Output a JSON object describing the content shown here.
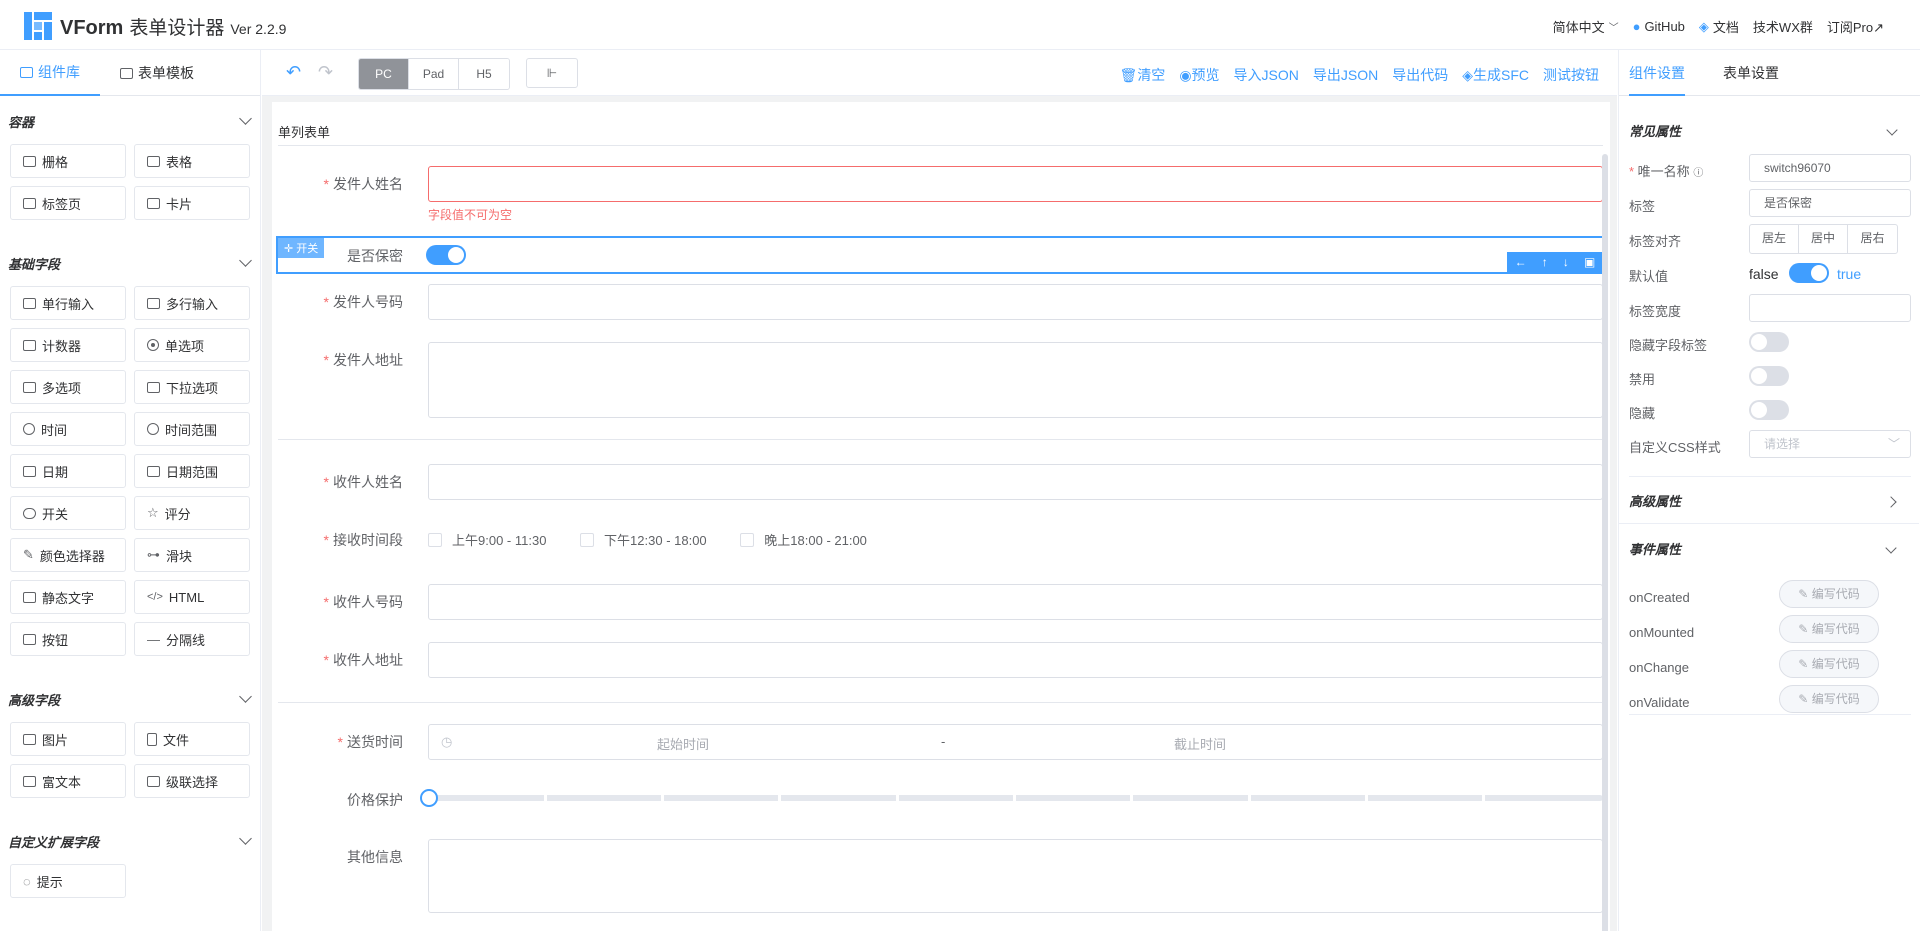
{
  "app": {
    "brand": "VForm",
    "title_zh": "表单设计器",
    "version": "Ver 2.2.9",
    "nav": {
      "lang": "简体中文",
      "github": "GitHub",
      "docs": "文档",
      "wx": "技术WX群",
      "pro": "订阅Pro↗"
    }
  },
  "left": {
    "tabs": [
      "组件库",
      "表单模板"
    ],
    "sections": [
      {
        "title": "容器",
        "items": [
          "栅格",
          "表格",
          "标签页",
          "卡片"
        ]
      },
      {
        "title": "基础字段",
        "items": [
          "单行输入",
          "多行输入",
          "计数器",
          "单选项",
          "多选项",
          "下拉选项",
          "时间",
          "时间范围",
          "日期",
          "日期范围",
          "开关",
          "评分",
          "颜色选择器",
          "滑块",
          "静态文字",
          "HTML",
          "按钮",
          "分隔线"
        ]
      },
      {
        "title": "高级字段",
        "items": [
          "图片",
          "文件",
          "富文本",
          "级联选择"
        ]
      },
      {
        "title": "自定义扩展字段",
        "items": [
          "提示"
        ]
      }
    ]
  },
  "toolbar": {
    "devices": [
      "PC",
      "Pad",
      "H5"
    ],
    "active_device": "PC",
    "actions": [
      "清空",
      "预览",
      "导入JSON",
      "导出JSON",
      "导出代码",
      "生成SFC",
      "测试按钮"
    ]
  },
  "form": {
    "title": "单列表单",
    "sender_name": "发件人姓名",
    "error": "字段值不可为空",
    "selected_tag": "开关",
    "secret": "是否保密",
    "sender_phone": "发件人号码",
    "sender_addr": "发件人地址",
    "recv_name": "收件人姓名",
    "recv_time": "接收时间段",
    "time_options": [
      "上午9:00 - 11:30",
      "下午12:30 - 18:00",
      "晚上18:00 - 21:00"
    ],
    "recv_phone": "收件人号码",
    "recv_addr": "收件人地址",
    "delivery": "送货时间",
    "start_ph": "起始时间",
    "sep": "-",
    "end_ph": "截止时间",
    "price": "价格保护",
    "other": "其他信息"
  },
  "right": {
    "tabs": [
      "组件设置",
      "表单设置"
    ],
    "common_title": "常见属性",
    "unique_label": "唯一名称",
    "unique_value": "switch96070",
    "label_label": "标签",
    "label_value": "是否保密",
    "align_label": "标签对齐",
    "align_options": [
      "居左",
      "居中",
      "居右"
    ],
    "default_label": "默认值",
    "default_false": "false",
    "default_true": "true",
    "width_label": "标签宽度",
    "hide_label_label": "隐藏字段标签",
    "disabled_label": "禁用",
    "hidden_label": "隐藏",
    "css_label": "自定义CSS样式",
    "css_placeholder": "请选择",
    "advanced_title": "高级属性",
    "event_title": "事件属性",
    "events": [
      "onCreated",
      "onMounted",
      "onChange",
      "onValidate"
    ],
    "code_btn": "编写代码"
  },
  "colors": {
    "accent": "#409eff",
    "error": "#f56c6c"
  }
}
